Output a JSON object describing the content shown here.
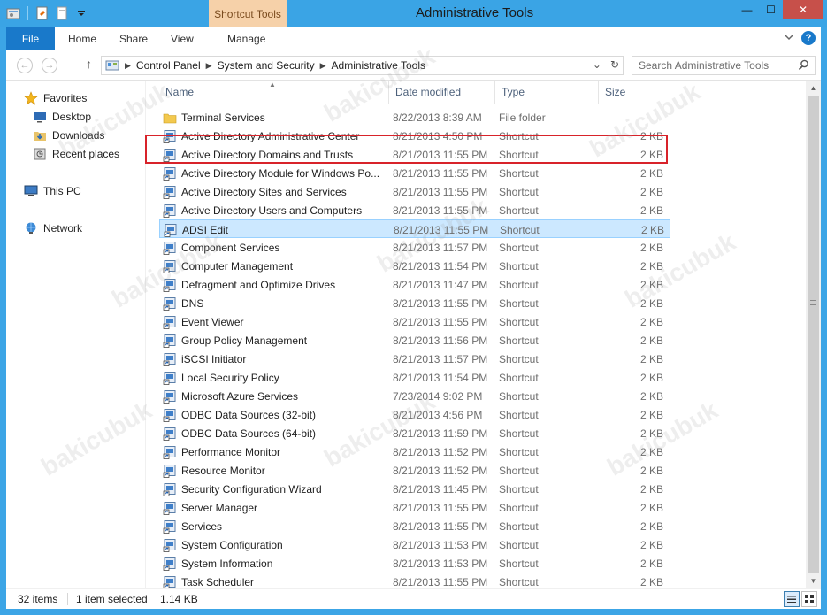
{
  "window": {
    "title": "Administrative Tools",
    "contextual_tab": "Shortcut Tools",
    "controls": {
      "minimize": "—",
      "maximize": "☐",
      "close": "✕"
    }
  },
  "ribbon": {
    "tabs": [
      "File",
      "Home",
      "Share",
      "View",
      "Manage"
    ],
    "expand_icon": "chevron-down-icon",
    "help_label": "?"
  },
  "address": {
    "breadcrumbs": [
      "Control Panel",
      "System and Security",
      "Administrative Tools"
    ],
    "search_placeholder": "Search Administrative Tools"
  },
  "nav_pane": {
    "items": [
      {
        "label": "Favorites",
        "icon": "star-icon"
      },
      {
        "label": "Desktop",
        "icon": "desktop-icon"
      },
      {
        "label": "Downloads",
        "icon": "downloads-icon"
      },
      {
        "label": "Recent places",
        "icon": "recent-places-icon"
      },
      {
        "label": "This PC",
        "icon": "computer-icon"
      },
      {
        "label": "Network",
        "icon": "network-icon"
      }
    ]
  },
  "columns": {
    "name": "Name",
    "date": "Date modified",
    "type": "Type",
    "size": "Size"
  },
  "files": [
    {
      "name": "Terminal Services",
      "date": "8/22/2013 8:39 AM",
      "type": "File folder",
      "size": "",
      "icon": "folder-icon"
    },
    {
      "name": "Active Directory Administrative Center",
      "date": "8/21/2013 4:50 PM",
      "type": "Shortcut",
      "size": "2 KB",
      "icon": "shortcut-icon"
    },
    {
      "name": "Active Directory Domains and Trusts",
      "date": "8/21/2013 11:55 PM",
      "type": "Shortcut",
      "size": "2 KB",
      "icon": "shortcut-icon"
    },
    {
      "name": "Active Directory Module for Windows Po...",
      "date": "8/21/2013 11:55 PM",
      "type": "Shortcut",
      "size": "2 KB",
      "icon": "shortcut-icon"
    },
    {
      "name": "Active Directory Sites and Services",
      "date": "8/21/2013 11:55 PM",
      "type": "Shortcut",
      "size": "2 KB",
      "icon": "shortcut-icon"
    },
    {
      "name": "Active Directory Users and Computers",
      "date": "8/21/2013 11:55 PM",
      "type": "Shortcut",
      "size": "2 KB",
      "icon": "shortcut-icon"
    },
    {
      "name": "ADSI Edit",
      "date": "8/21/2013 11:55 PM",
      "type": "Shortcut",
      "size": "2 KB",
      "icon": "shortcut-icon",
      "selected": true
    },
    {
      "name": "Component Services",
      "date": "8/21/2013 11:57 PM",
      "type": "Shortcut",
      "size": "2 KB",
      "icon": "shortcut-icon"
    },
    {
      "name": "Computer Management",
      "date": "8/21/2013 11:54 PM",
      "type": "Shortcut",
      "size": "2 KB",
      "icon": "shortcut-icon"
    },
    {
      "name": "Defragment and Optimize Drives",
      "date": "8/21/2013 11:47 PM",
      "type": "Shortcut",
      "size": "2 KB",
      "icon": "shortcut-icon"
    },
    {
      "name": "DNS",
      "date": "8/21/2013 11:55 PM",
      "type": "Shortcut",
      "size": "2 KB",
      "icon": "shortcut-icon"
    },
    {
      "name": "Event Viewer",
      "date": "8/21/2013 11:55 PM",
      "type": "Shortcut",
      "size": "2 KB",
      "icon": "shortcut-icon"
    },
    {
      "name": "Group Policy Management",
      "date": "8/21/2013 11:56 PM",
      "type": "Shortcut",
      "size": "2 KB",
      "icon": "shortcut-icon"
    },
    {
      "name": "iSCSI Initiator",
      "date": "8/21/2013 11:57 PM",
      "type": "Shortcut",
      "size": "2 KB",
      "icon": "shortcut-icon"
    },
    {
      "name": "Local Security Policy",
      "date": "8/21/2013 11:54 PM",
      "type": "Shortcut",
      "size": "2 KB",
      "icon": "shortcut-icon"
    },
    {
      "name": "Microsoft Azure Services",
      "date": "7/23/2014 9:02 PM",
      "type": "Shortcut",
      "size": "2 KB",
      "icon": "shortcut-icon"
    },
    {
      "name": "ODBC Data Sources (32-bit)",
      "date": "8/21/2013 4:56 PM",
      "type": "Shortcut",
      "size": "2 KB",
      "icon": "shortcut-icon"
    },
    {
      "name": "ODBC Data Sources (64-bit)",
      "date": "8/21/2013 11:59 PM",
      "type": "Shortcut",
      "size": "2 KB",
      "icon": "shortcut-icon"
    },
    {
      "name": "Performance Monitor",
      "date": "8/21/2013 11:52 PM",
      "type": "Shortcut",
      "size": "2 KB",
      "icon": "shortcut-icon"
    },
    {
      "name": "Resource Monitor",
      "date": "8/21/2013 11:52 PM",
      "type": "Shortcut",
      "size": "2 KB",
      "icon": "shortcut-icon"
    },
    {
      "name": "Security Configuration Wizard",
      "date": "8/21/2013 11:45 PM",
      "type": "Shortcut",
      "size": "2 KB",
      "icon": "shortcut-icon"
    },
    {
      "name": "Server Manager",
      "date": "8/21/2013 11:55 PM",
      "type": "Shortcut",
      "size": "2 KB",
      "icon": "shortcut-icon"
    },
    {
      "name": "Services",
      "date": "8/21/2013 11:55 PM",
      "type": "Shortcut",
      "size": "2 KB",
      "icon": "shortcut-icon"
    },
    {
      "name": "System Configuration",
      "date": "8/21/2013 11:53 PM",
      "type": "Shortcut",
      "size": "2 KB",
      "icon": "shortcut-icon"
    },
    {
      "name": "System Information",
      "date": "8/21/2013 11:53 PM",
      "type": "Shortcut",
      "size": "2 KB",
      "icon": "shortcut-icon"
    },
    {
      "name": "Task Scheduler",
      "date": "8/21/2013 11:55 PM",
      "type": "Shortcut",
      "size": "2 KB",
      "icon": "shortcut-icon"
    }
  ],
  "status": {
    "item_count": "32 items",
    "selection": "1 item selected",
    "selection_size": "1.14 KB"
  },
  "colors": {
    "accent": "#1979ca",
    "title_bar": "#3aa4e5",
    "contextual_tab": "#f6d1a9",
    "selection": "#cce8ff",
    "highlight_box": "#d8232a"
  },
  "watermark": "bakicubuk"
}
